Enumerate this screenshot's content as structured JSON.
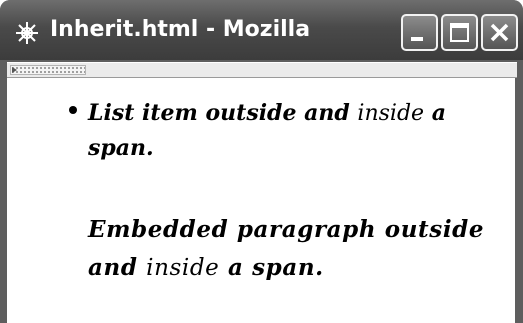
{
  "window": {
    "title": "Inherit.html - Mozilla",
    "controls": [
      "minimize",
      "maximize",
      "close"
    ]
  },
  "toolbar": {
    "grip": "toolbar-grip-icon"
  },
  "content": {
    "list_item": {
      "before": "List item outside and",
      "inside": "inside",
      "after": "a span."
    },
    "paragraph": {
      "before": "Embedded paragraph outside and",
      "inside": "inside",
      "after": "a span."
    }
  },
  "colors": {
    "titlebar": "#4a4a4a",
    "frame": "#5e5e5e",
    "content_bg": "#ffffff",
    "text": "#000000"
  }
}
